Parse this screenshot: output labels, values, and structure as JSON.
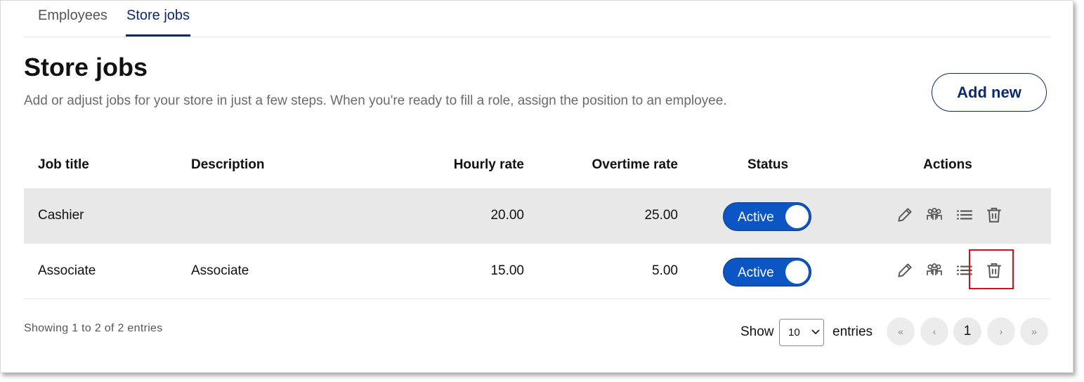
{
  "tabs": [
    {
      "label": "Employees",
      "active": false
    },
    {
      "label": "Store jobs",
      "active": true
    }
  ],
  "page": {
    "title": "Store jobs",
    "subtitle": "Add or adjust jobs for your store in just a few steps. When you're ready to fill a role, assign the position to an employee.",
    "add_button": "Add new"
  },
  "table": {
    "headers": {
      "title": "Job title",
      "description": "Description",
      "hourly": "Hourly rate",
      "overtime": "Overtime rate",
      "status": "Status",
      "actions": "Actions"
    },
    "rows": [
      {
        "title": "Cashier",
        "description": "",
        "hourly": "20.00",
        "overtime": "25.00",
        "status": "Active"
      },
      {
        "title": "Associate",
        "description": "Associate",
        "hourly": "15.00",
        "overtime": "5.00",
        "status": "Active"
      }
    ]
  },
  "footer": {
    "showing": "Showing 1 to 2 of 2 entries",
    "show_label": "Show",
    "page_size": "10",
    "entries_label": "entries",
    "pagination": {
      "first": "«",
      "prev": "‹",
      "current": "1",
      "next": "›",
      "last": "»"
    }
  },
  "colors": {
    "brand": "#0b2a6b",
    "toggle": "#0b55c4",
    "highlight": "#d0131a"
  },
  "icons": [
    "pencil-icon",
    "team-icon",
    "list-icon",
    "trash-icon",
    "chevron-down-icon"
  ]
}
